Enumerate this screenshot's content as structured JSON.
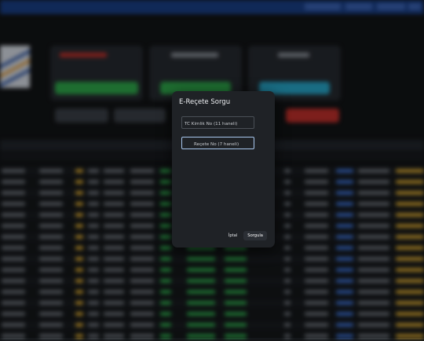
{
  "dialog": {
    "title": "E-Reçete Sorgu",
    "tc_field": {
      "placeholder": "TC Kimlik No (11 haneli)",
      "value": ""
    },
    "recete_field": {
      "placeholder": "Reçete No (7 haneli)",
      "value": ""
    },
    "cancel_label": "İptal",
    "submit_label": "Sorgula"
  },
  "colors": {
    "top_bar": "#1a3f86",
    "dialog_bg": "#1f2226",
    "focus_border": "#a8c7ee",
    "green": "#2ea84b",
    "cyan": "#27a6c9",
    "red": "#c0302b",
    "blue_badge": "#3b6fd0",
    "yellow": "#d6a631"
  }
}
